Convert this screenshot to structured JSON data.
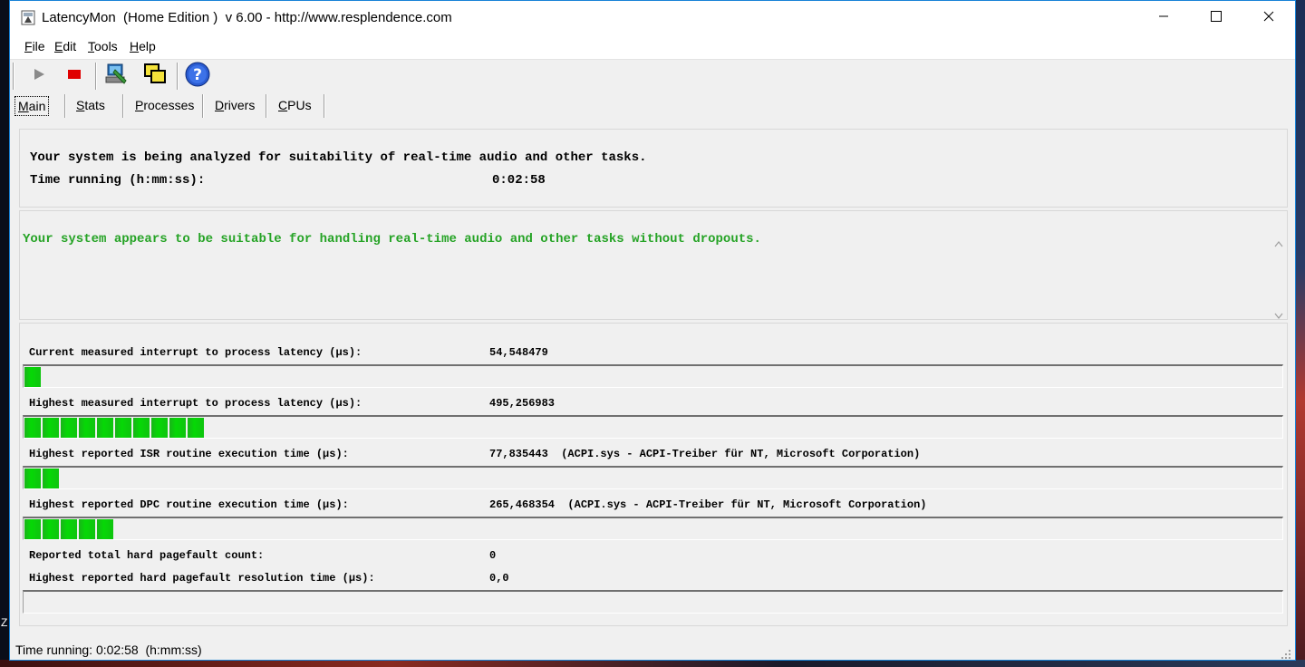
{
  "window": {
    "title": "LatencyMon  (Home Edition )  v 6.00 - http://www.resplendence.com"
  },
  "menu": {
    "file": {
      "u": "F",
      "rest": "ile"
    },
    "edit": {
      "u": "E",
      "rest": "dit"
    },
    "tools": {
      "u": "T",
      "rest": "ools"
    },
    "help": {
      "u": "H",
      "rest": "elp"
    }
  },
  "toolbar": {
    "icons": [
      "play-icon",
      "stop-icon",
      "analyze-icon",
      "windows-icon",
      "help-icon"
    ]
  },
  "tabs": {
    "main": {
      "u": "M",
      "rest": "ain"
    },
    "stats": {
      "u": "S",
      "rest": "tats"
    },
    "processes": {
      "u": "P",
      "rest": "rocesses"
    },
    "drivers": {
      "u": "D",
      "rest": "rivers"
    },
    "cpus": {
      "u": "C",
      "rest": "PUs"
    }
  },
  "status": {
    "line1": "Your system is being analyzed for suitability of real-time audio and other tasks.",
    "time_label": "Time running (h:mm:ss):",
    "time_value": "0:02:58"
  },
  "conclusion": {
    "text": "Your system appears to be suitable for handling real-time audio and other tasks without dropouts.",
    "color": "#25a325"
  },
  "metrics": {
    "current_latency": {
      "label": "Current measured interrupt to process latency (µs):",
      "value": "54,548479",
      "segments": 1
    },
    "highest_latency": {
      "label": "Highest measured interrupt to process latency (µs):",
      "value": "495,256983",
      "segments": 10
    },
    "isr": {
      "label": "Highest reported ISR routine execution time (µs):",
      "value": "77,835443  (ACPI.sys - ACPI-Treiber für NT, Microsoft Corporation)",
      "segments": 2
    },
    "dpc": {
      "label": "Highest reported DPC routine execution time (µs):",
      "value": "265,468354  (ACPI.sys - ACPI-Treiber für NT, Microsoft Corporation)",
      "segments": 5
    },
    "pagefault_count": {
      "label": "Reported total hard pagefault count:",
      "value": "0"
    },
    "pagefault_time": {
      "label": "Highest reported hard pagefault resolution time (µs):",
      "value": "0,0",
      "segments": 0
    }
  },
  "statusbar": {
    "text": "Time running: 0:02:58  (h:mm:ss)"
  },
  "desktop": {
    "edge_letter": "Z"
  },
  "colors": {
    "bar_green": "#06d806",
    "accent_border": "#1883d7"
  }
}
